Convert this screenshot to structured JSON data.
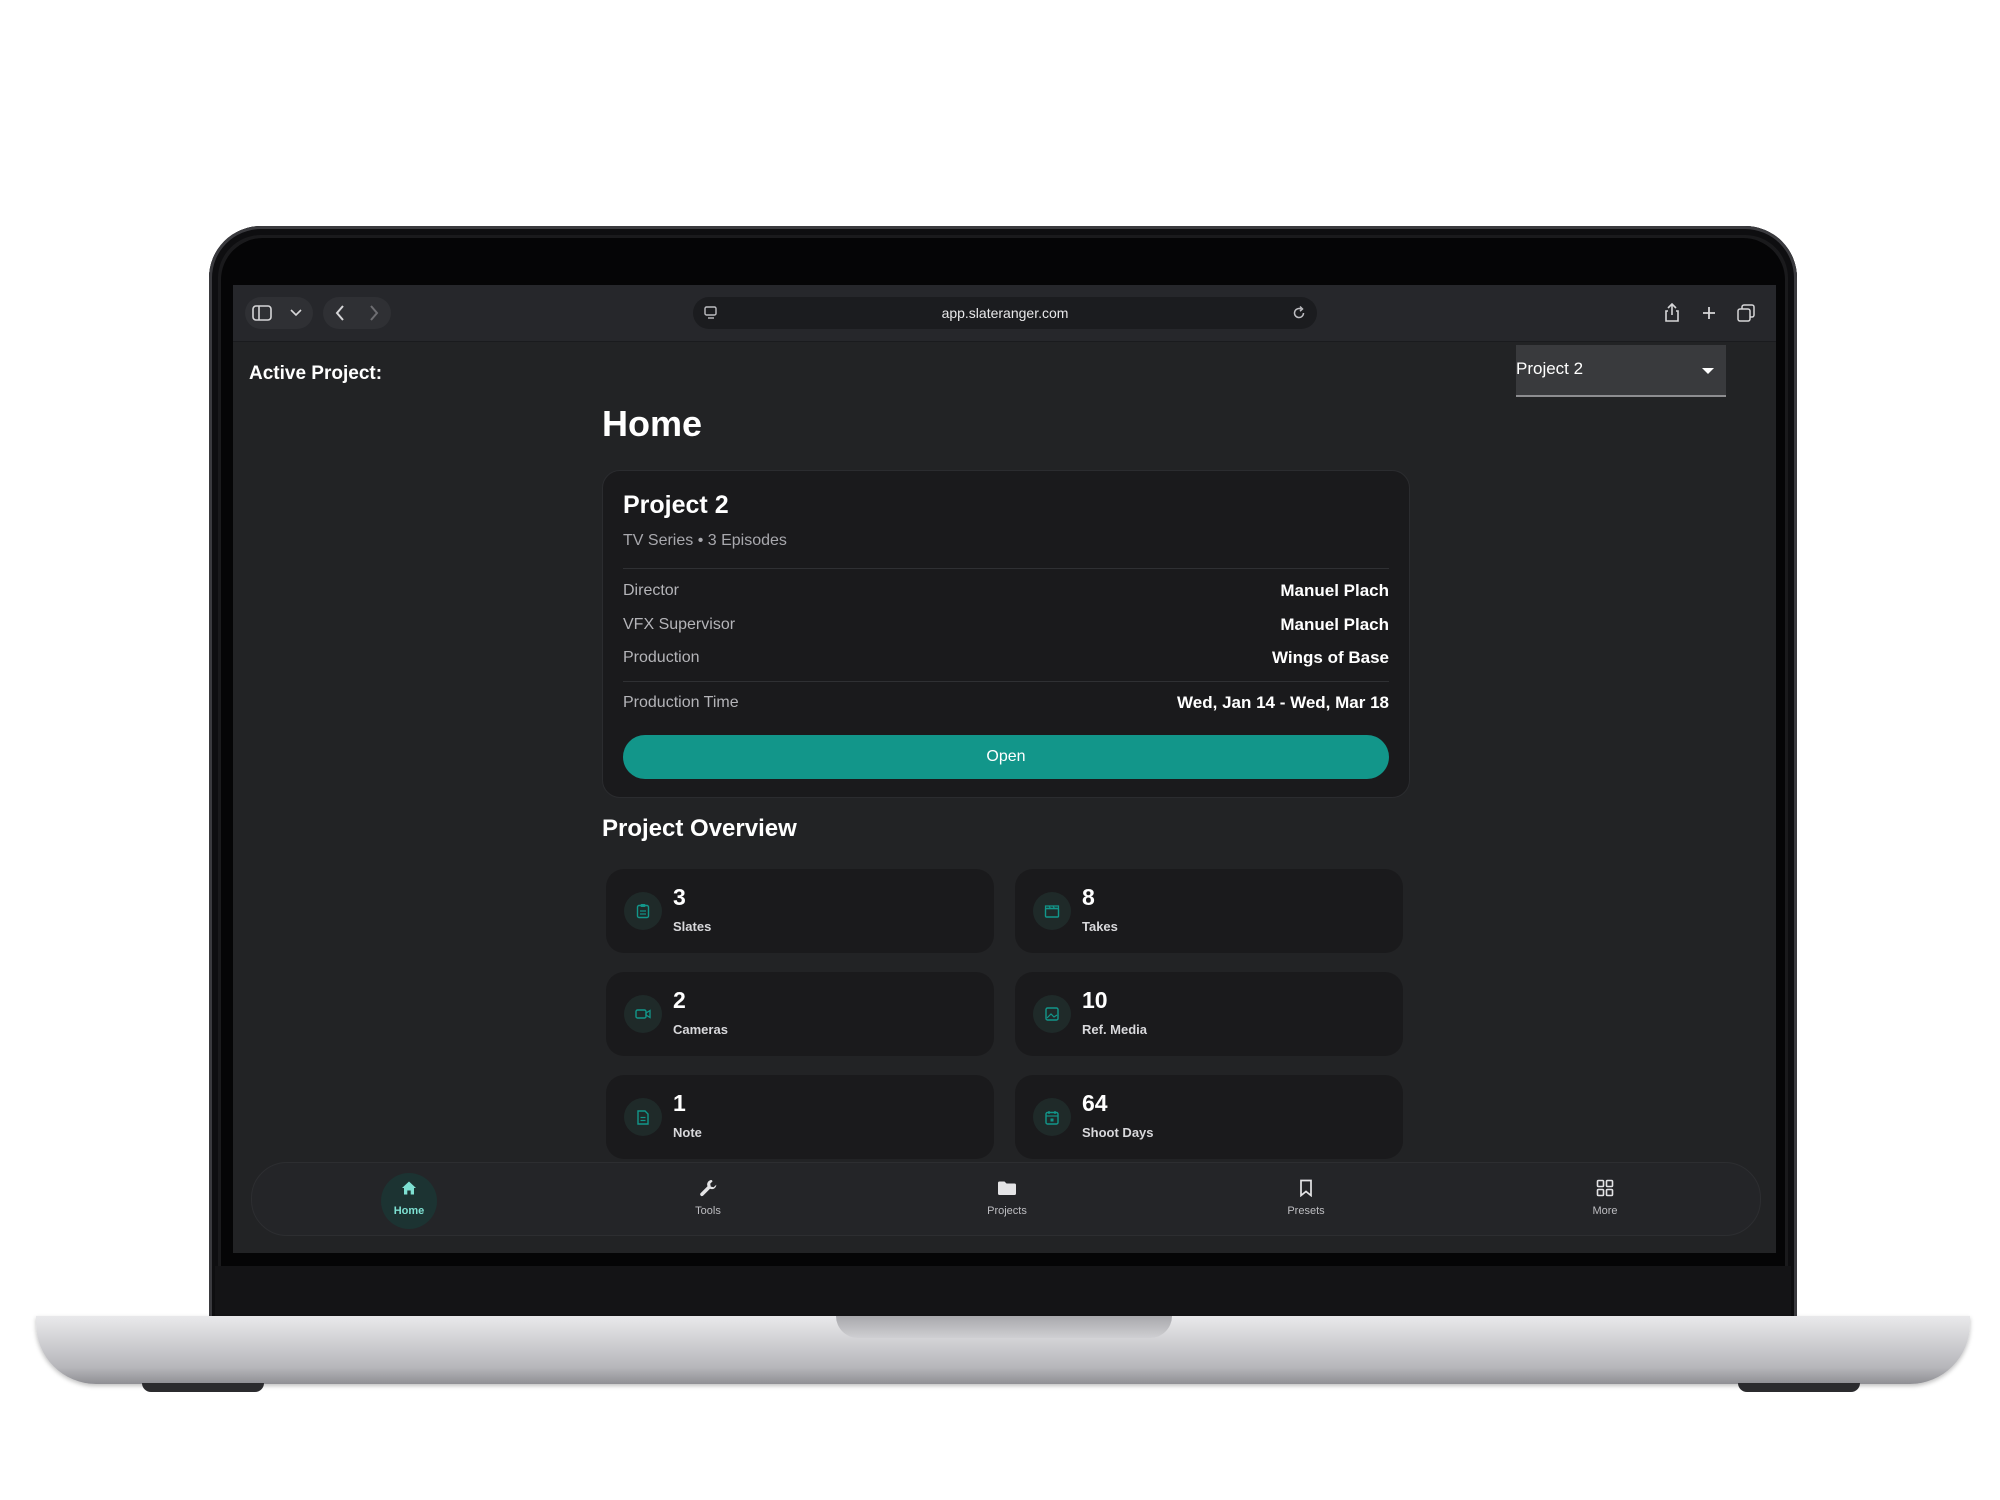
{
  "browser": {
    "url": "app.slateranger.com"
  },
  "header": {
    "active_project_label": "Active Project:",
    "project_select_value": "Project 2"
  },
  "page": {
    "title": "Home"
  },
  "project_card": {
    "name": "Project 2",
    "subtitle": "TV Series • 3 Episodes",
    "rows": [
      {
        "label": "Director",
        "value": "Manuel Plach"
      },
      {
        "label": "VFX Supervisor",
        "value": "Manuel Plach"
      },
      {
        "label": "Production",
        "value": "Wings of Base"
      }
    ],
    "production_time_label": "Production Time",
    "production_time_value": "Wed, Jan 14 - Wed, Mar 18",
    "open_label": "Open"
  },
  "overview": {
    "title": "Project Overview",
    "stats": [
      {
        "value": "3",
        "label": "Slates",
        "icon": "clipboard-icon"
      },
      {
        "value": "8",
        "label": "Takes",
        "icon": "clapperboard-icon"
      },
      {
        "value": "2",
        "label": "Cameras",
        "icon": "video-camera-icon"
      },
      {
        "value": "10",
        "label": "Ref. Media",
        "icon": "image-icon"
      },
      {
        "value": "1",
        "label": "Note",
        "icon": "document-icon"
      },
      {
        "value": "64",
        "label": "Shoot Days",
        "icon": "calendar-icon"
      }
    ]
  },
  "nav": {
    "items": [
      {
        "label": "Home",
        "icon": "home-icon",
        "active": true
      },
      {
        "label": "Tools",
        "icon": "wrench-icon",
        "active": false
      },
      {
        "label": "Projects",
        "icon": "folder-icon",
        "active": false
      },
      {
        "label": "Presets",
        "icon": "bookmark-icon",
        "active": false
      },
      {
        "label": "More",
        "icon": "grid-icon",
        "active": false
      }
    ]
  },
  "colors": {
    "accent": "#12968a",
    "background": "#222325",
    "card": "#1a1a1c"
  }
}
